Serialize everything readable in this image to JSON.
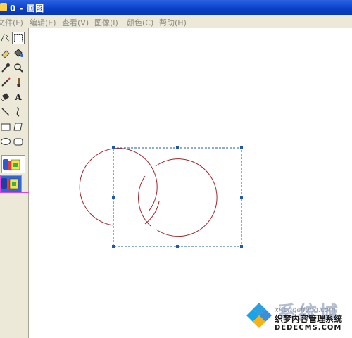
{
  "window": {
    "title": "0 - 画图",
    "menu": [
      "文件(F)",
      "编辑(E)",
      "查看(V)",
      "图像(I)",
      "颜色(C)",
      "帮助(H)"
    ]
  },
  "toolbox": {
    "tools": [
      "free-form-select",
      "select",
      "eraser",
      "fill-with-color",
      "pick-color",
      "magnifier",
      "pencil",
      "brush",
      "airbrush",
      "text",
      "line",
      "curve",
      "rectangle",
      "polygon",
      "ellipse",
      "rounded-rectangle"
    ],
    "selected_tool": "select",
    "text_tool_glyph": "A",
    "selection_modes": [
      "opaque",
      "transparent"
    ],
    "active_selection_mode": "transparent"
  },
  "canvas": {
    "shapes": [
      "circle",
      "circle"
    ],
    "stroke_color": "#a0282e",
    "selection_color": "#1f5aa8",
    "annotation_color": "#d946d9"
  },
  "watermark": {
    "brand": "系统城",
    "url": "xitongcheng.com",
    "cn_text": "织梦内容管理系统",
    "site": "DEDECMS.COM"
  }
}
